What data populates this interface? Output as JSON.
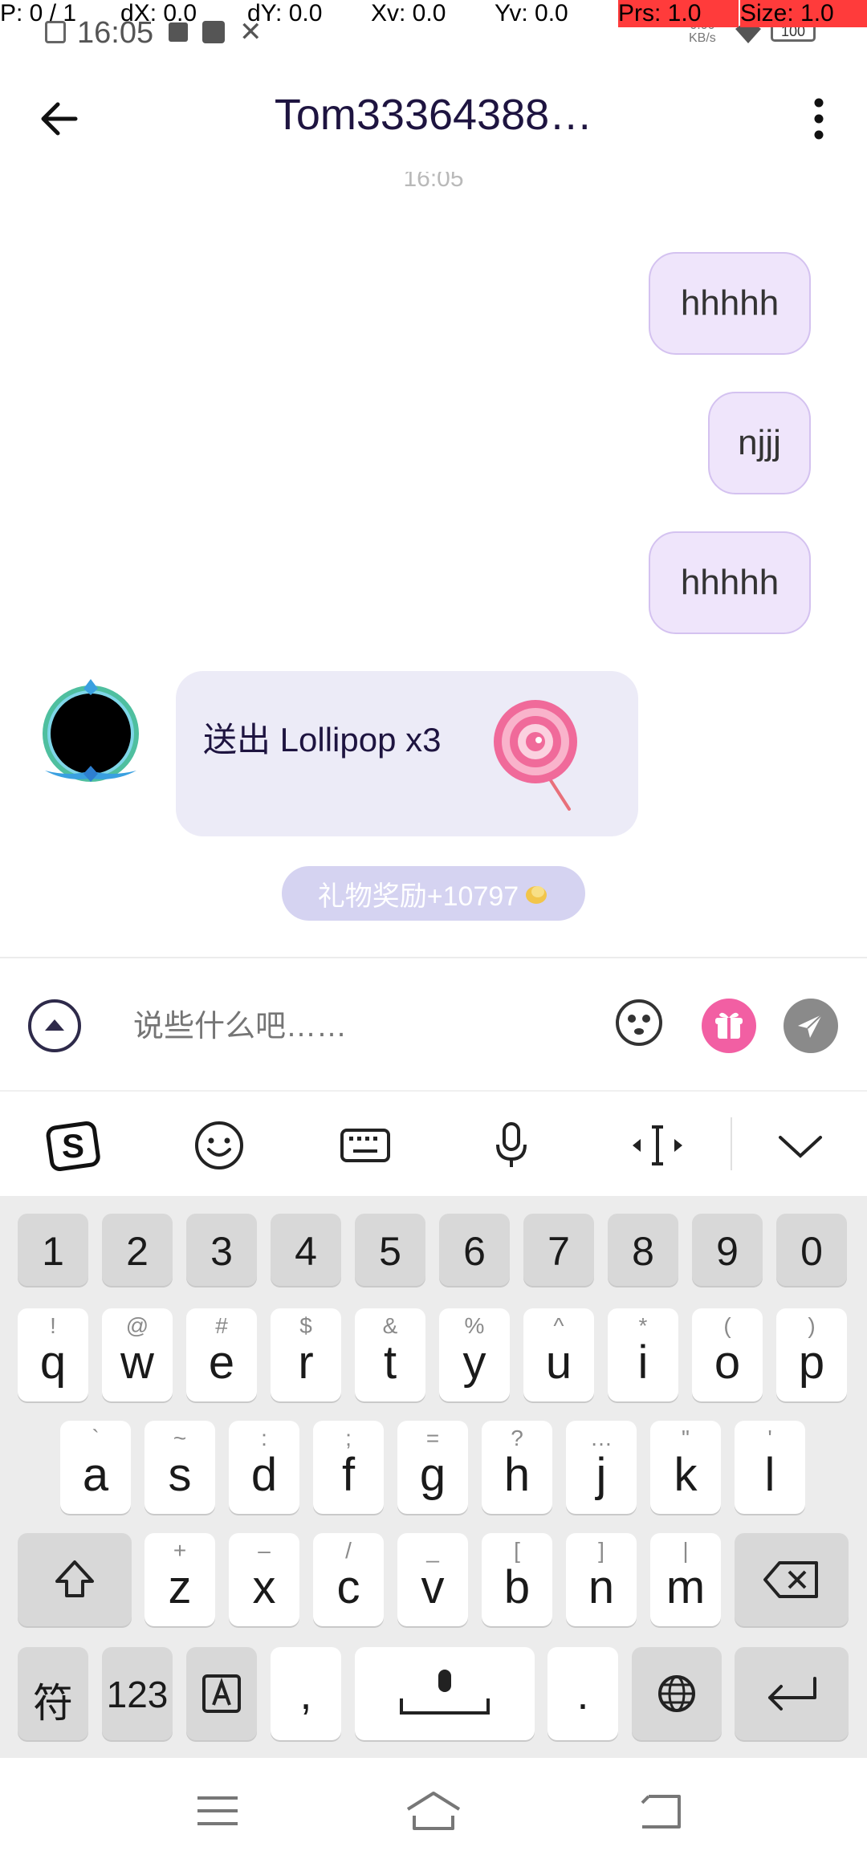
{
  "debug_overlay": {
    "pointer": "P: 0 / 1",
    "dx": "dX: 0.0",
    "dy": "dY: 0.0",
    "xv": "Xv: 0.0",
    "yv": "Yv: 0.0",
    "prs": "Prs: 1.0",
    "size": "Size: 1.0"
  },
  "status_bar": {
    "time": "16:05",
    "net_speed_value": "0.00",
    "net_speed_unit": "KB/s",
    "battery": "100"
  },
  "header": {
    "title": "Tom33364388…"
  },
  "chat": {
    "time_label": "16:05",
    "messages": [
      {
        "text": "hhhhh"
      },
      {
        "text": "njjj"
      },
      {
        "text": "hhhhh"
      }
    ],
    "gift_message": {
      "text": "送出 Lollipop x3"
    },
    "reward_text": "礼物奖励+10797"
  },
  "input_bar": {
    "placeholder": "说些什么吧……"
  },
  "keyboard": {
    "number_row": [
      "1",
      "2",
      "3",
      "4",
      "5",
      "6",
      "7",
      "8",
      "9",
      "0"
    ],
    "row1": [
      {
        "key": "q",
        "sym": "!"
      },
      {
        "key": "w",
        "sym": "@"
      },
      {
        "key": "e",
        "sym": "#"
      },
      {
        "key": "r",
        "sym": "$"
      },
      {
        "key": "t",
        "sym": "&"
      },
      {
        "key": "y",
        "sym": "%"
      },
      {
        "key": "u",
        "sym": "^"
      },
      {
        "key": "i",
        "sym": "*"
      },
      {
        "key": "o",
        "sym": "("
      },
      {
        "key": "p",
        "sym": ")"
      }
    ],
    "row2": [
      {
        "key": "a",
        "sym": "`"
      },
      {
        "key": "s",
        "sym": "~"
      },
      {
        "key": "d",
        "sym": ":"
      },
      {
        "key": "f",
        "sym": ";"
      },
      {
        "key": "g",
        "sym": "="
      },
      {
        "key": "h",
        "sym": "?"
      },
      {
        "key": "j",
        "sym": "…"
      },
      {
        "key": "k",
        "sym": "\""
      },
      {
        "key": "l",
        "sym": "'"
      }
    ],
    "row3": [
      {
        "key": "z",
        "sym": "+"
      },
      {
        "key": "x",
        "sym": "–"
      },
      {
        "key": "c",
        "sym": "/"
      },
      {
        "key": "v",
        "sym": "_"
      },
      {
        "key": "b",
        "sym": "["
      },
      {
        "key": "n",
        "sym": "]"
      },
      {
        "key": "m",
        "sym": "|"
      }
    ],
    "symbol_key": "符",
    "num_key": "123",
    "comma_key": ",",
    "period_key": "."
  },
  "colors": {
    "accent_purple": "#1e1440",
    "bubble_out": "#efe5fb",
    "gift_button": "#f25fa3",
    "debug_red": "#ff3b3b"
  }
}
